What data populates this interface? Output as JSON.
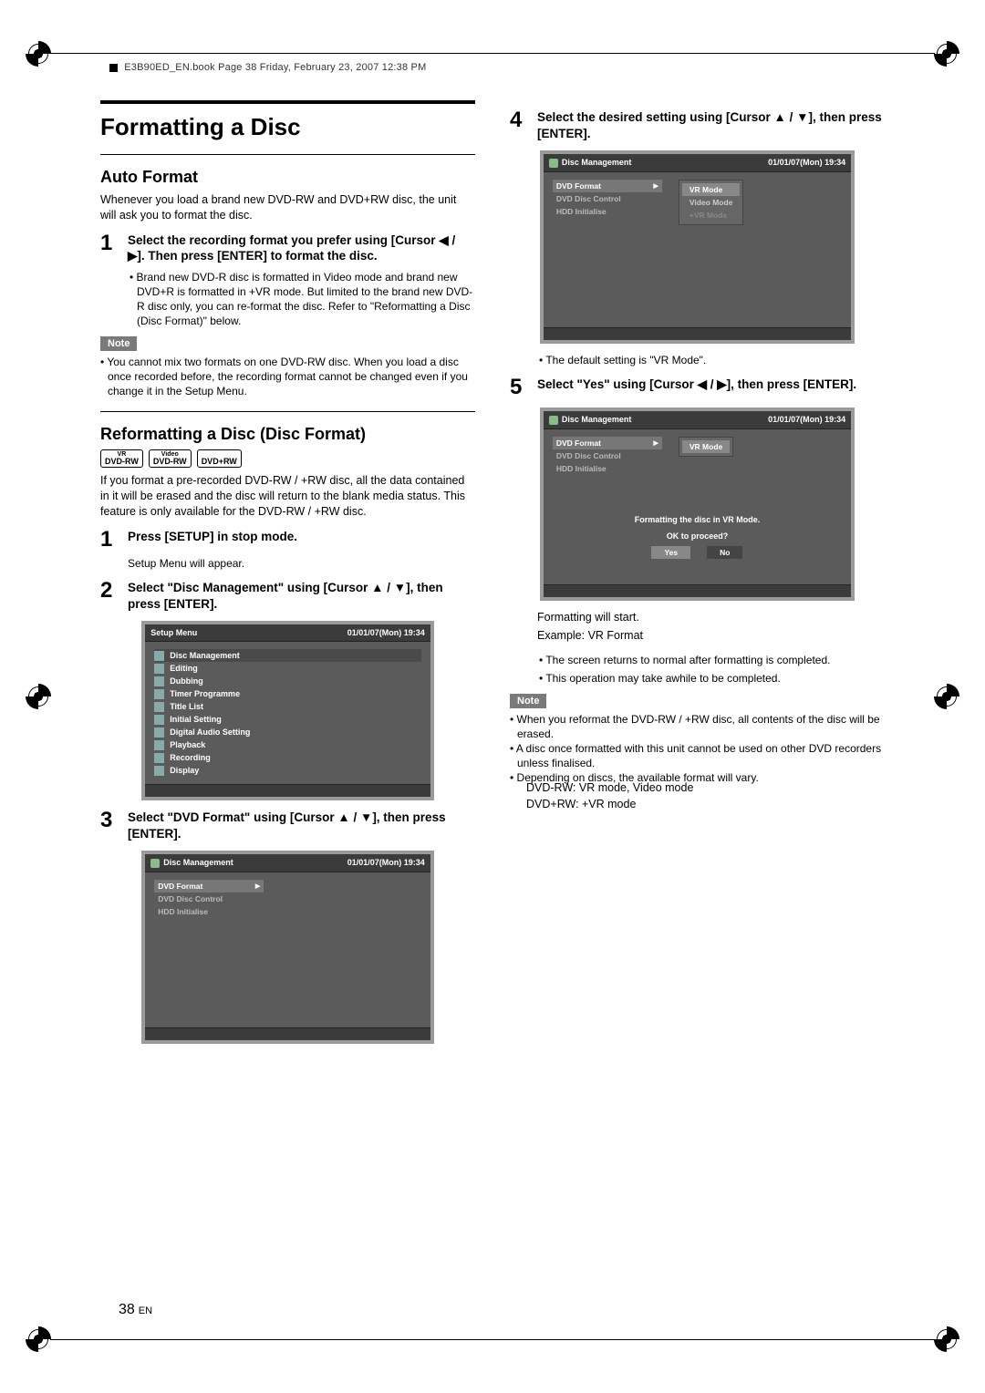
{
  "header_note": "E3B90ED_EN.book  Page 38  Friday, February 23, 2007  12:38 PM",
  "page_number": "38",
  "page_lang": "EN",
  "left": {
    "title": "Formatting a Disc",
    "auto_format": {
      "heading": "Auto Format",
      "body": "Whenever you load a brand new DVD-RW and DVD+RW disc, the unit will ask you to format the disc.",
      "step1": "Select the recording format you prefer using [Cursor ◀ / ▶]. Then press [ENTER] to format the disc.",
      "step1_bullet": "Brand new DVD-R disc is formatted in Video mode and brand new DVD+R is formatted in +VR mode. But limited to the brand new DVD-R disc only, you can re-format the disc. Refer to \"Reformatting a Disc (Disc Format)\" below.",
      "note_label": "Note",
      "note1": "You cannot mix two formats on one DVD-RW disc. When you load a disc once recorded before, the recording format cannot be changed even if you change it in the Setup Menu."
    },
    "reformat": {
      "heading": "Reformatting a Disc (Disc Format)",
      "badges": {
        "b1_top": "VR",
        "b1": "DVD-RW",
        "b2_top": "Video",
        "b2": "DVD-RW",
        "b3": "DVD+RW"
      },
      "body": "If you format a pre-recorded DVD-RW / +RW disc, all the data contained in it will be erased and the disc will return to the blank media status. This feature is only available for the DVD-RW / +RW disc.",
      "step1": "Press [SETUP] in stop mode.",
      "step1_sub": "Setup Menu will appear.",
      "step2": "Select \"Disc Management\" using [Cursor ▲ / ▼], then press [ENTER].",
      "setup_menu": {
        "title": "Setup Menu",
        "datetime": "01/01/07(Mon)   19:34",
        "items": [
          "Disc Management",
          "Editing",
          "Dubbing",
          "Timer Programme",
          "Title List",
          "Initial Setting",
          "Digital Audio Setting",
          "Playback",
          "Recording",
          "Display"
        ]
      },
      "step3": "Select \"DVD Format\" using [Cursor ▲ / ▼], then press [ENTER].",
      "dm_menu": {
        "title": "Disc Management",
        "datetime": "01/01/07(Mon)   19:34",
        "items": [
          "DVD Format",
          "DVD Disc Control",
          "HDD Initialise"
        ]
      }
    }
  },
  "right": {
    "step4": "Select the desired setting using [Cursor ▲ / ▼], then press [ENTER].",
    "screen4": {
      "title": "Disc Management",
      "datetime": "01/01/07(Mon)   19:34",
      "side": [
        "DVD Format",
        "DVD Disc Control",
        "HDD Initialise"
      ],
      "options": [
        "VR Mode",
        "Video Mode",
        "+VR Mode"
      ]
    },
    "step4_note": "The default setting is \"VR Mode\".",
    "step5": "Select \"Yes\" using [Cursor ◀ / ▶], then press [ENTER].",
    "screen5": {
      "title": "Disc Management",
      "datetime": "01/01/07(Mon)   19:34",
      "side": [
        "DVD Format",
        "DVD Disc Control",
        "HDD Initialise"
      ],
      "selected_mode": "VR Mode",
      "confirm_line1": "Formatting the disc in VR Mode.",
      "confirm_line2": "OK to proceed?",
      "yes": "Yes",
      "no": "No"
    },
    "result1": "Formatting will start.",
    "result2": "Example: VR Format",
    "bullet1": "The screen returns to normal after formatting is completed.",
    "bullet2": "This operation may take awhile to be completed.",
    "note_label": "Note",
    "note_a": "When you reformat the DVD-RW / +RW disc, all contents of the disc will be erased.",
    "note_b": "A disc once formatted with this unit cannot be used on other DVD recorders unless finalised.",
    "note_c": "Depending on discs, the available format will vary.",
    "note_c_sub1": "DVD-RW: VR mode, Video mode",
    "note_c_sub2": "DVD+RW: +VR mode"
  }
}
